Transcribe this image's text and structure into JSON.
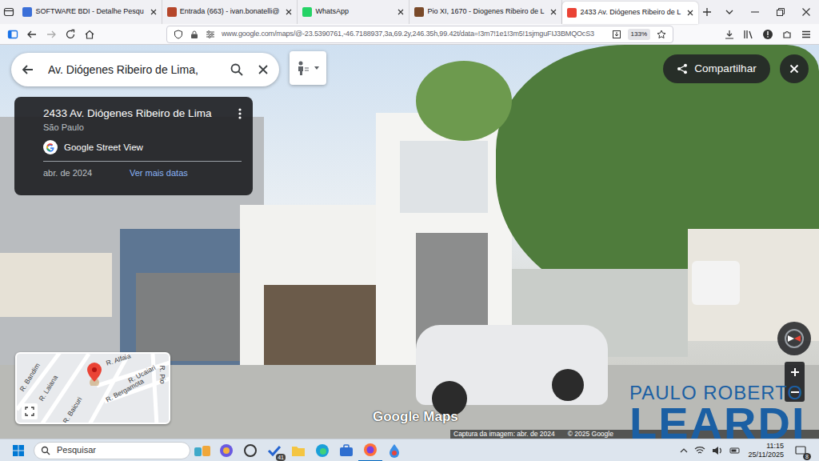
{
  "browser": {
    "tabs": [
      {
        "label": "SOFTWARE BDI - Detalhe Pesqu",
        "selected": false
      },
      {
        "label": "Entrada (663) - ivan.bonatelli@",
        "selected": false
      },
      {
        "label": "WhatsApp",
        "selected": false
      },
      {
        "label": "Pio XI, 1670 - Diogenes Ribeiro de L",
        "selected": false
      },
      {
        "label": "2433 Av. Diógenes Ribeiro de L",
        "selected": true
      }
    ],
    "url": "www.google.com/maps/@-23.5390761,-46.7188937,3a,69.2y,246.35h,99.42t/data=!3m7!1e1!3m5!1sjmguFIJ3BMQOcS3",
    "zoom": "133%"
  },
  "maps": {
    "search": {
      "value": "Av. Diógenes Ribeiro de Lima,"
    },
    "card": {
      "title": "2433 Av. Diógenes Ribeiro de Lima",
      "subtitle": "São Paulo",
      "source": "Google Street View",
      "date": "abr. de 2024",
      "more_dates": "Ver mais datas"
    },
    "share": "Compartilhar",
    "minimap": {
      "streets": [
        "R. Bandim",
        "R. Laiana",
        "R. Alfaia",
        "R. Ucaiari",
        "R. Bergamota",
        "R. Baicuri",
        "R. Pio"
      ]
    },
    "logo": "Google Maps",
    "footer": [
      "Captura da imagem: abr. de 2024",
      "© 2025 Google"
    ]
  },
  "watermark": {
    "line1": "PAULO ROBERTO",
    "line2": "LEARDI"
  },
  "taskbar": {
    "search": "Pesquisar",
    "badge": "41",
    "time": "11:15",
    "date": "25/11/2025",
    "notifications": "8"
  }
}
